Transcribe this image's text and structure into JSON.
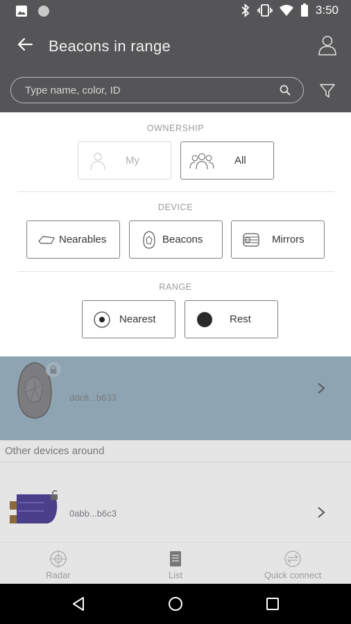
{
  "status_bar": {
    "time": "3:50",
    "icons": [
      "image-icon",
      "circle-icon",
      "bluetooth-icon",
      "vibrate-icon",
      "wifi-icon",
      "battery-icon"
    ]
  },
  "app_bar": {
    "title": "Beacons in range",
    "search_placeholder": "Type name, color, ID",
    "icons": [
      "back-arrow-icon",
      "profile-icon",
      "search-icon",
      "filter-icon"
    ]
  },
  "filters": {
    "ownership": {
      "label": "OWNERSHIP",
      "options": [
        {
          "label": "My",
          "selected": false,
          "enabled": false
        },
        {
          "label": "All",
          "selected": true,
          "enabled": true
        }
      ]
    },
    "device": {
      "label": "DEVICE",
      "options": [
        {
          "label": "Nearables",
          "icon": "nearable-icon"
        },
        {
          "label": "Beacons",
          "icon": "beacon-icon"
        },
        {
          "label": "Mirrors",
          "icon": "mirror-icon"
        }
      ]
    },
    "range": {
      "label": "RANGE",
      "options": [
        {
          "label": "Nearest",
          "icon": "radio-target-icon"
        },
        {
          "label": "Rest",
          "icon": "filled-dot-icon"
        }
      ]
    }
  },
  "devices": {
    "my_devices": [
      {
        "id": "ddc8...b633",
        "icon": "beacon-device-icon",
        "badge": "lock-icon"
      }
    ],
    "other_header": "Other devices around",
    "other_devices": [
      {
        "id": "0abb...b6c3",
        "icon": "beacon-stick-icon",
        "badge": "unlock-icon"
      }
    ]
  },
  "bottom_nav": [
    {
      "label": "Radar",
      "icon": "radar-icon"
    },
    {
      "label": "List",
      "icon": "list-icon"
    },
    {
      "label": "Quick connect",
      "icon": "quick-connect-icon"
    }
  ],
  "system_nav": [
    "back-triangle-icon",
    "home-circle-icon",
    "recents-square-icon"
  ],
  "colors": {
    "header_bg": "#555557",
    "highlight_row": "#8fa4b2",
    "overlay_grey": "#e5e5e5",
    "beacon_device": "#4b3f8c"
  }
}
